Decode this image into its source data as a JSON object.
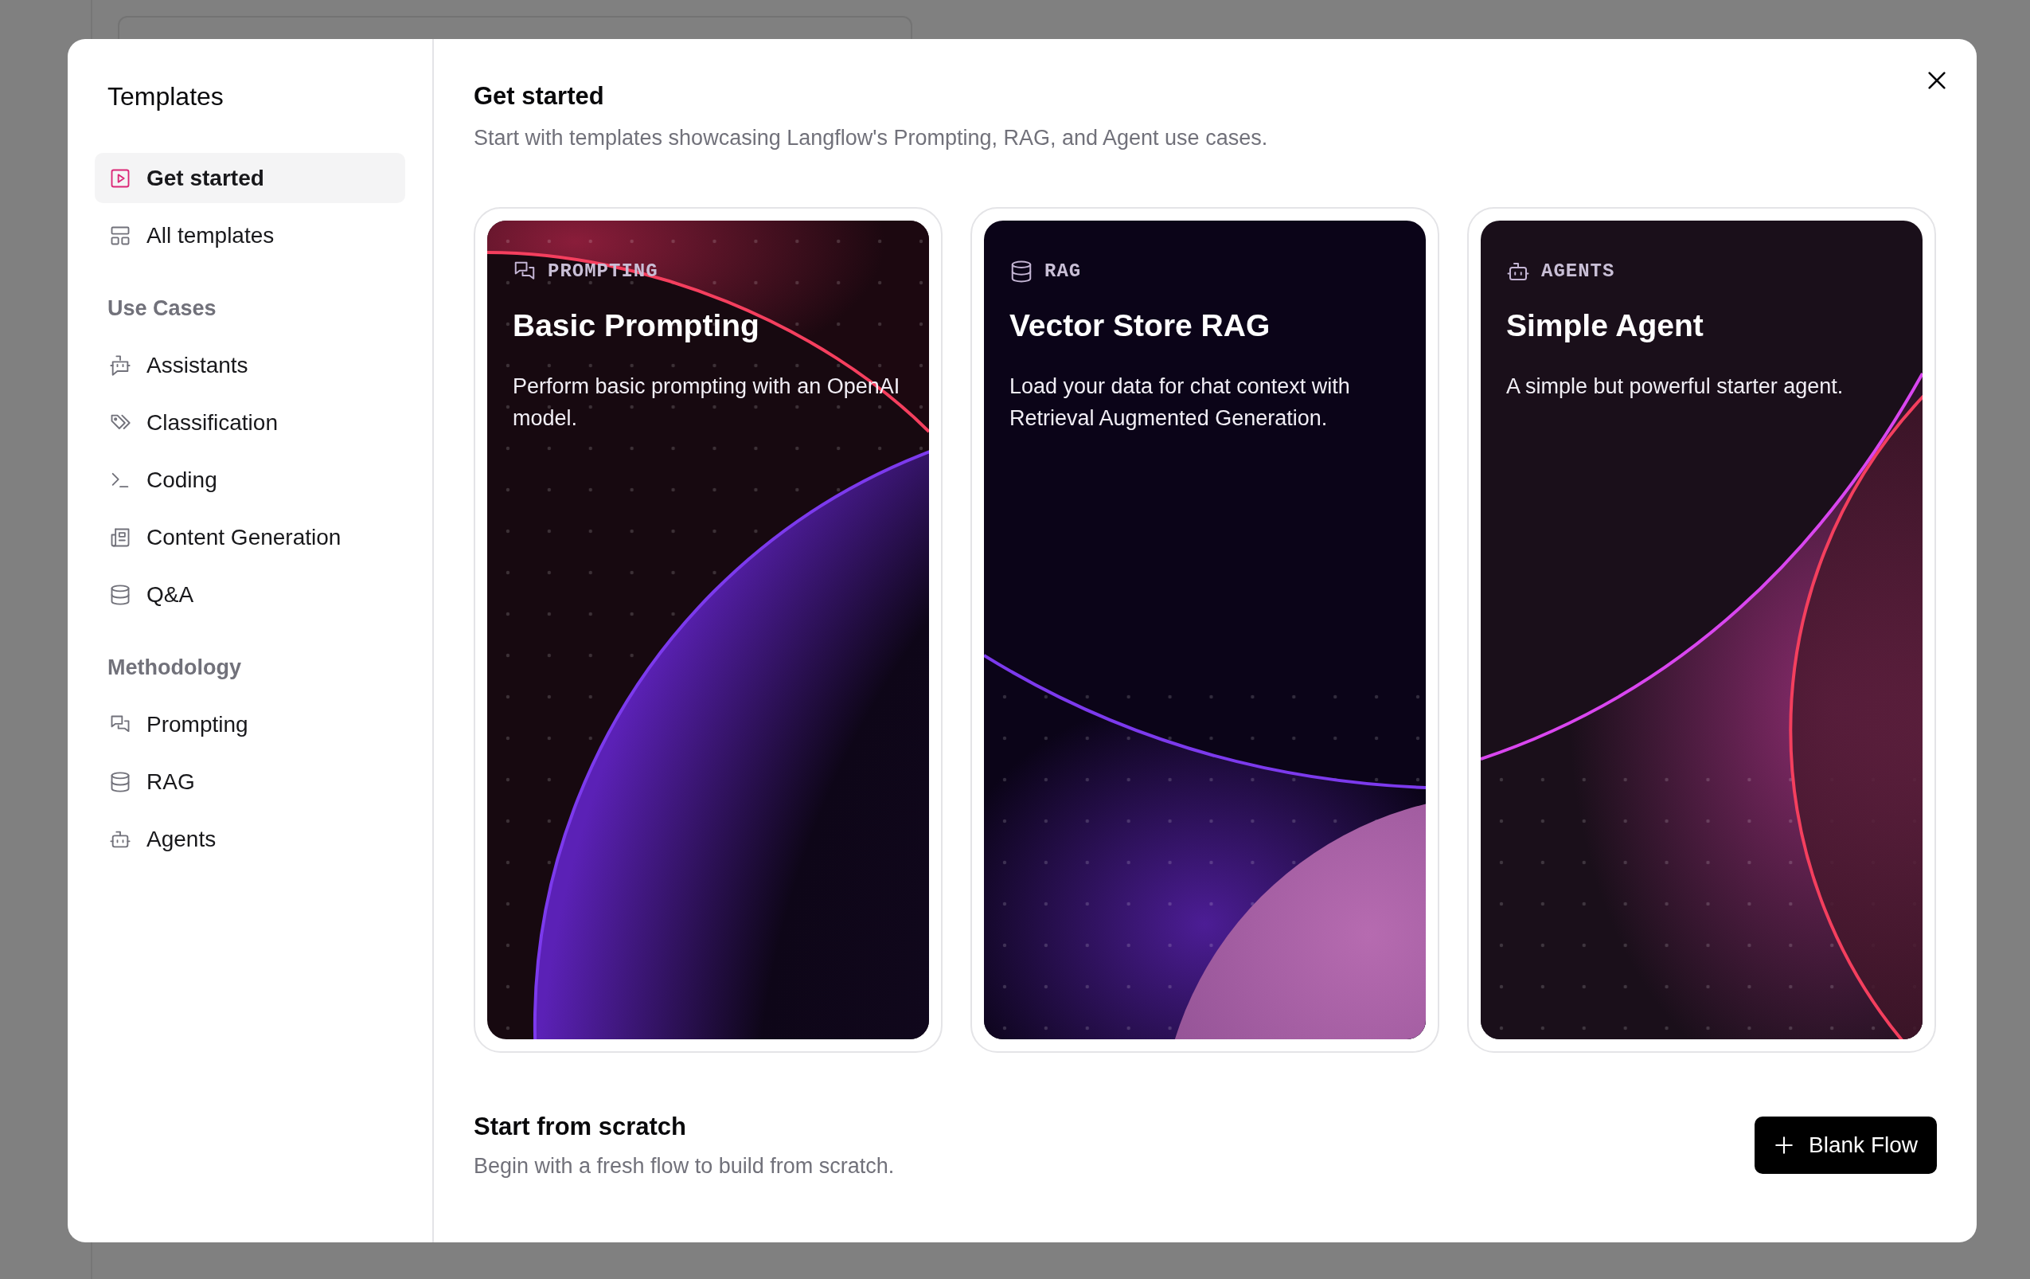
{
  "sidebar": {
    "title": "Templates",
    "items": [
      {
        "label": "Get started",
        "selected": true
      },
      {
        "label": "All templates",
        "selected": false
      }
    ],
    "sections": [
      {
        "heading": "Use Cases",
        "items": [
          {
            "label": "Assistants",
            "selected": false
          },
          {
            "label": "Classification",
            "selected": false
          },
          {
            "label": "Coding",
            "selected": false
          },
          {
            "label": "Content Generation",
            "selected": false
          },
          {
            "label": "Q&A",
            "selected": false
          }
        ]
      },
      {
        "heading": "Methodology",
        "items": [
          {
            "label": "Prompting",
            "selected": false
          },
          {
            "label": "RAG",
            "selected": false
          },
          {
            "label": "Agents",
            "selected": false
          }
        ]
      }
    ]
  },
  "main": {
    "title": "Get started",
    "subtitle": "Start with templates showcasing Langflow's Prompting, RAG, and Agent use cases.",
    "templates": [
      {
        "category": "PROMPTING",
        "title": "Basic Prompting",
        "description": "Perform basic prompting with an OpenAI model."
      },
      {
        "category": "RAG",
        "title": "Vector Store RAG",
        "description": "Load your data for chat context with Retrieval Augmented Generation."
      },
      {
        "category": "AGENTS",
        "title": "Simple Agent",
        "description": "A simple but powerful starter agent."
      }
    ],
    "scratch": {
      "title": "Start from scratch",
      "description": "Begin with a fresh flow to build from scratch.",
      "button": "Blank Flow"
    }
  }
}
